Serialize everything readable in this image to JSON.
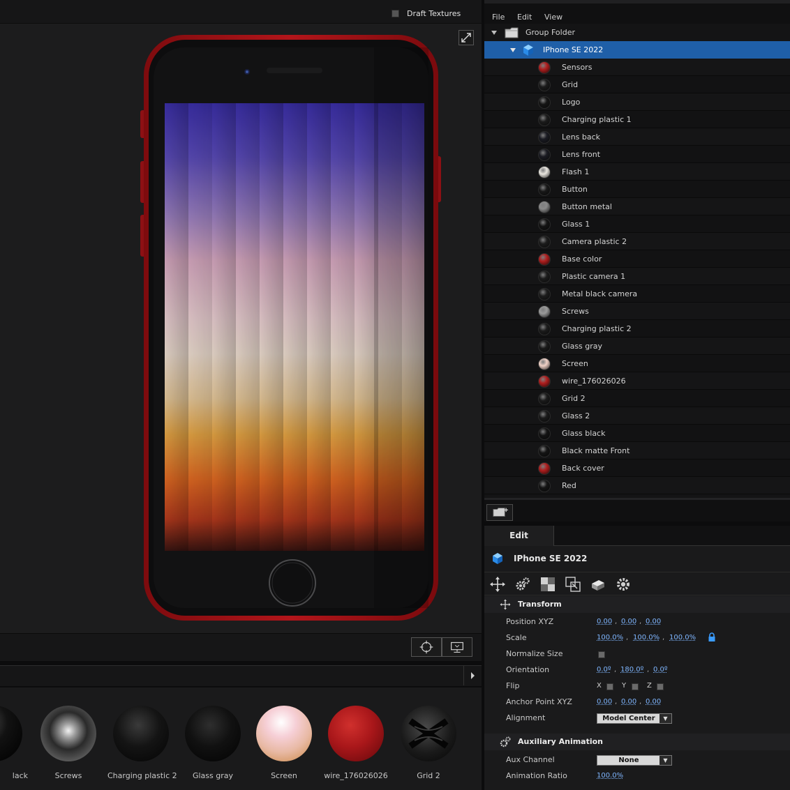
{
  "viewport": {
    "draft_textures_label": "Draft Textures",
    "draft_textures_checked": false
  },
  "menu": {
    "file": "File",
    "edit": "Edit",
    "view": "View"
  },
  "tree": {
    "group_folder": "Group Folder",
    "selected_object": "IPhone SE 2022",
    "materials": [
      {
        "name": "Sensors",
        "color": "#b01e1e"
      },
      {
        "name": "Grid",
        "color": "#1b1b1b"
      },
      {
        "name": "Logo",
        "color": "#151515"
      },
      {
        "name": "Charging plastic 1",
        "color": "#1c1c1c"
      },
      {
        "name": "Lens back",
        "color": "#1a1b22"
      },
      {
        "name": "Lens front",
        "color": "#1a1b22"
      },
      {
        "name": "Flash 1",
        "color": "#e9e6df"
      },
      {
        "name": "Button",
        "color": "#181818"
      },
      {
        "name": "Button metal",
        "color": "#8a8a8a"
      },
      {
        "name": "Glass 1",
        "color": "#141414"
      },
      {
        "name": "Camera plastic 2",
        "color": "#1c1c1c"
      },
      {
        "name": "Base color",
        "color": "#b01e1e"
      },
      {
        "name": "Plastic camera 1",
        "color": "#1c1c1c"
      },
      {
        "name": "Metal black camera",
        "color": "#1d1d1d"
      },
      {
        "name": "Screws",
        "color": "#9a9a9a"
      },
      {
        "name": "Charging plastic 2",
        "color": "#1c1c1c"
      },
      {
        "name": "Glass gray",
        "color": "#1a1a1a"
      },
      {
        "name": "Screen",
        "color": "#f1d2c7"
      },
      {
        "name": "wire_176026026",
        "color": "#b01e1e"
      },
      {
        "name": "Grid 2",
        "color": "#1b1b1b"
      },
      {
        "name": "Glass 2",
        "color": "#1a1a1a"
      },
      {
        "name": "Glass black",
        "color": "#141414"
      },
      {
        "name": "Black matte Front",
        "color": "#141414"
      },
      {
        "name": "Back cover",
        "color": "#b01e1e"
      },
      {
        "name": "Red",
        "color": "#141414"
      }
    ]
  },
  "edit": {
    "tab_label": "Edit",
    "object_name": "IPhone SE 2022",
    "transform_label": "Transform",
    "props": {
      "position_label": "Position XYZ",
      "position": [
        "0.00",
        "0.00",
        "0.00"
      ],
      "scale_label": "Scale",
      "scale": [
        "100.0%",
        "100.0%",
        "100.0%"
      ],
      "normalize_label": "Normalize Size",
      "orientation_label": "Orientation",
      "orientation": [
        "0.0º",
        "180.0º",
        "0.0º"
      ],
      "flip_label": "Flip",
      "flip_x": "X",
      "flip_y": "Y",
      "flip_z": "Z",
      "anchor_label": "Anchor Point XYZ",
      "anchor": [
        "0.00",
        "0.00",
        "0.00"
      ],
      "alignment_label": "Alignment",
      "alignment_value": "Model Center"
    },
    "aux_label": "Auxiliary Animation",
    "aux": {
      "channel_label": "Aux Channel",
      "channel_value": "None",
      "ratio_label": "Animation Ratio",
      "ratio_value": "100.0%"
    }
  },
  "material_strip": [
    {
      "name": "Glass black",
      "visible_label": "lack"
    },
    {
      "name": "Screws",
      "visible_label": "Screws"
    },
    {
      "name": "Charging plastic 2",
      "visible_label": "Charging plastic 2"
    },
    {
      "name": "Glass gray",
      "visible_label": "Glass gray"
    },
    {
      "name": "Screen",
      "visible_label": "Screen"
    },
    {
      "name": "wire_176026026",
      "visible_label": "wire_176026026"
    },
    {
      "name": "Grid 2",
      "visible_label": "Grid 2"
    }
  ]
}
